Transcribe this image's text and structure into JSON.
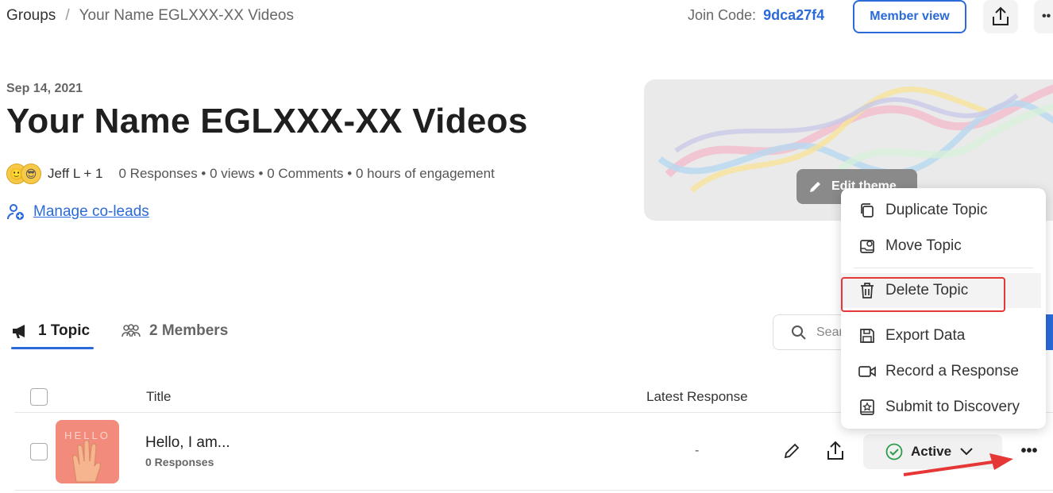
{
  "breadcrumb": {
    "root": "Groups",
    "separator": "/",
    "current": "Your Name EGLXXX-XX Videos"
  },
  "header": {
    "join_label": "Join Code:",
    "join_code": "9dca27f4",
    "member_view": "Member view"
  },
  "group": {
    "date": "Sep 14, 2021",
    "title": "Your Name EGLXXX-XX Videos",
    "owner": "Jeff L + 1",
    "stats": "0 Responses • 0 views • 0 Comments • 0 hours of engagement",
    "manage_link": "Manage co-leads",
    "edit_theme": "Edit theme"
  },
  "tabs": {
    "topics": "1 Topic",
    "members": "2 Members"
  },
  "search": {
    "placeholder": "Sear"
  },
  "table": {
    "headers": {
      "title": "Title",
      "latest_response": "Latest Response"
    },
    "rows": [
      {
        "thumb_text": "HELLO",
        "title": "Hello, I am...",
        "subtitle": "0 Responses",
        "latest": "-",
        "status": "Active"
      }
    ]
  },
  "menu": {
    "items": [
      {
        "label": "Duplicate Topic",
        "icon": "duplicate-icon"
      },
      {
        "label": "Move Topic",
        "icon": "move-icon"
      },
      {
        "label": "Delete Topic",
        "icon": "trash-icon"
      },
      {
        "label": "Export Data",
        "icon": "save-icon"
      },
      {
        "label": "Record a Response",
        "icon": "video-icon"
      },
      {
        "label": "Submit to Discovery",
        "icon": "discovery-icon"
      }
    ]
  },
  "colors": {
    "accent": "#2b6ad9",
    "highlight_box": "#e63737",
    "active_check": "#2e9b4a"
  }
}
